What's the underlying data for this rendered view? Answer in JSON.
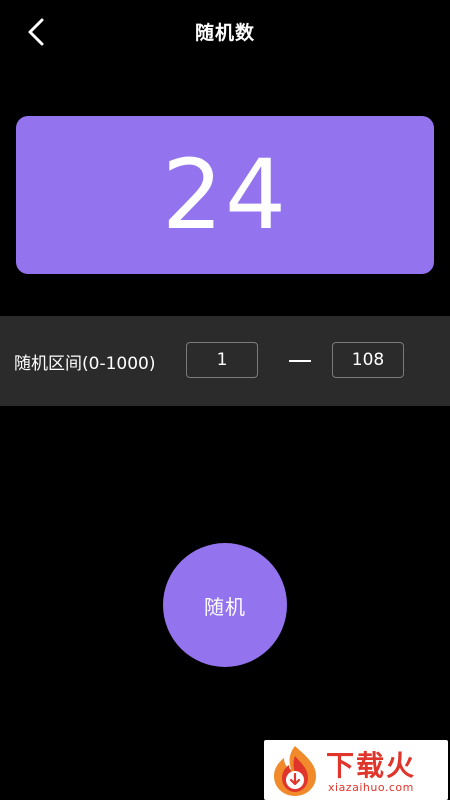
{
  "header": {
    "title": "随机数",
    "back_icon": "chevron-left-icon"
  },
  "result": {
    "value": "24"
  },
  "range": {
    "label": "随机区间(0-1000)",
    "min_value": "1",
    "max_value": "108"
  },
  "random_button": {
    "label": "随机"
  },
  "watermark": {
    "brand": "下载火",
    "domain": "xiazaihuo.com"
  },
  "colors": {
    "background": "#000000",
    "accent": "#9373ee",
    "range_bar": "#2b2b2b",
    "watermark_red": "#e0352b"
  }
}
